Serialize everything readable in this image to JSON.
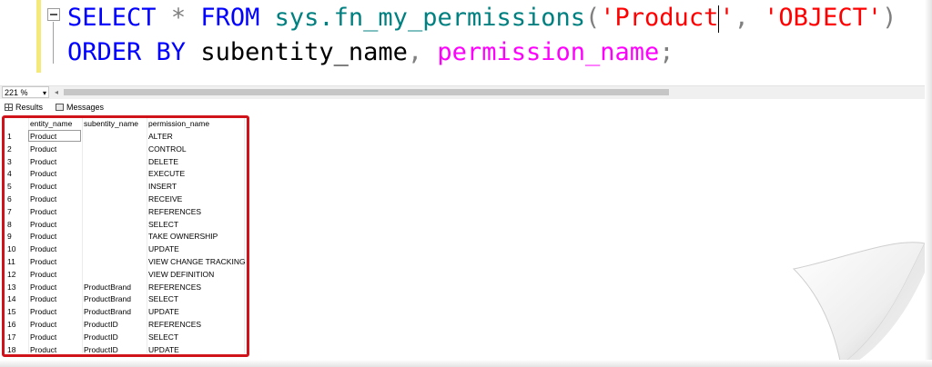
{
  "editor": {
    "line1": {
      "select_kw": "SELECT",
      "star": "*",
      "from_kw": "FROM",
      "function": "sys.fn_my_permissions",
      "open_paren": "(",
      "arg1_a": "'Product",
      "arg1_b": "'",
      "comma": ",",
      "arg2": "'OBJECT'",
      "close_paren": ")"
    },
    "line2": {
      "order_kw": "ORDER BY",
      "col1": "subentity_name",
      "comma": ",",
      "col2": "permission_name",
      "semicolon": ";"
    }
  },
  "zoom": {
    "value": "221 %"
  },
  "tabs": {
    "results": "Results",
    "messages": "Messages"
  },
  "grid": {
    "headers": [
      "entity_name",
      "subentity_name",
      "permission_name"
    ],
    "rows": [
      [
        "1",
        "Product",
        "",
        "ALTER"
      ],
      [
        "2",
        "Product",
        "",
        "CONTROL"
      ],
      [
        "3",
        "Product",
        "",
        "DELETE"
      ],
      [
        "4",
        "Product",
        "",
        "EXECUTE"
      ],
      [
        "5",
        "Product",
        "",
        "INSERT"
      ],
      [
        "6",
        "Product",
        "",
        "RECEIVE"
      ],
      [
        "7",
        "Product",
        "",
        "REFERENCES"
      ],
      [
        "8",
        "Product",
        "",
        "SELECT"
      ],
      [
        "9",
        "Product",
        "",
        "TAKE OWNERSHIP"
      ],
      [
        "10",
        "Product",
        "",
        "UPDATE"
      ],
      [
        "11",
        "Product",
        "",
        "VIEW CHANGE TRACKING"
      ],
      [
        "12",
        "Product",
        "",
        "VIEW DEFINITION"
      ],
      [
        "13",
        "Product",
        "ProductBrand",
        "REFERENCES"
      ],
      [
        "14",
        "Product",
        "ProductBrand",
        "SELECT"
      ],
      [
        "15",
        "Product",
        "ProductBrand",
        "UPDATE"
      ],
      [
        "16",
        "Product",
        "ProductID",
        "REFERENCES"
      ],
      [
        "17",
        "Product",
        "ProductID",
        "SELECT"
      ],
      [
        "18",
        "Product",
        "ProductID",
        "UPDATE"
      ]
    ]
  },
  "colors": {
    "keyword": "#0000ff",
    "function": "#008080",
    "string": "#ff0000",
    "identifier_pink": "#ff00ff",
    "highlight_box": "#d0121a"
  }
}
